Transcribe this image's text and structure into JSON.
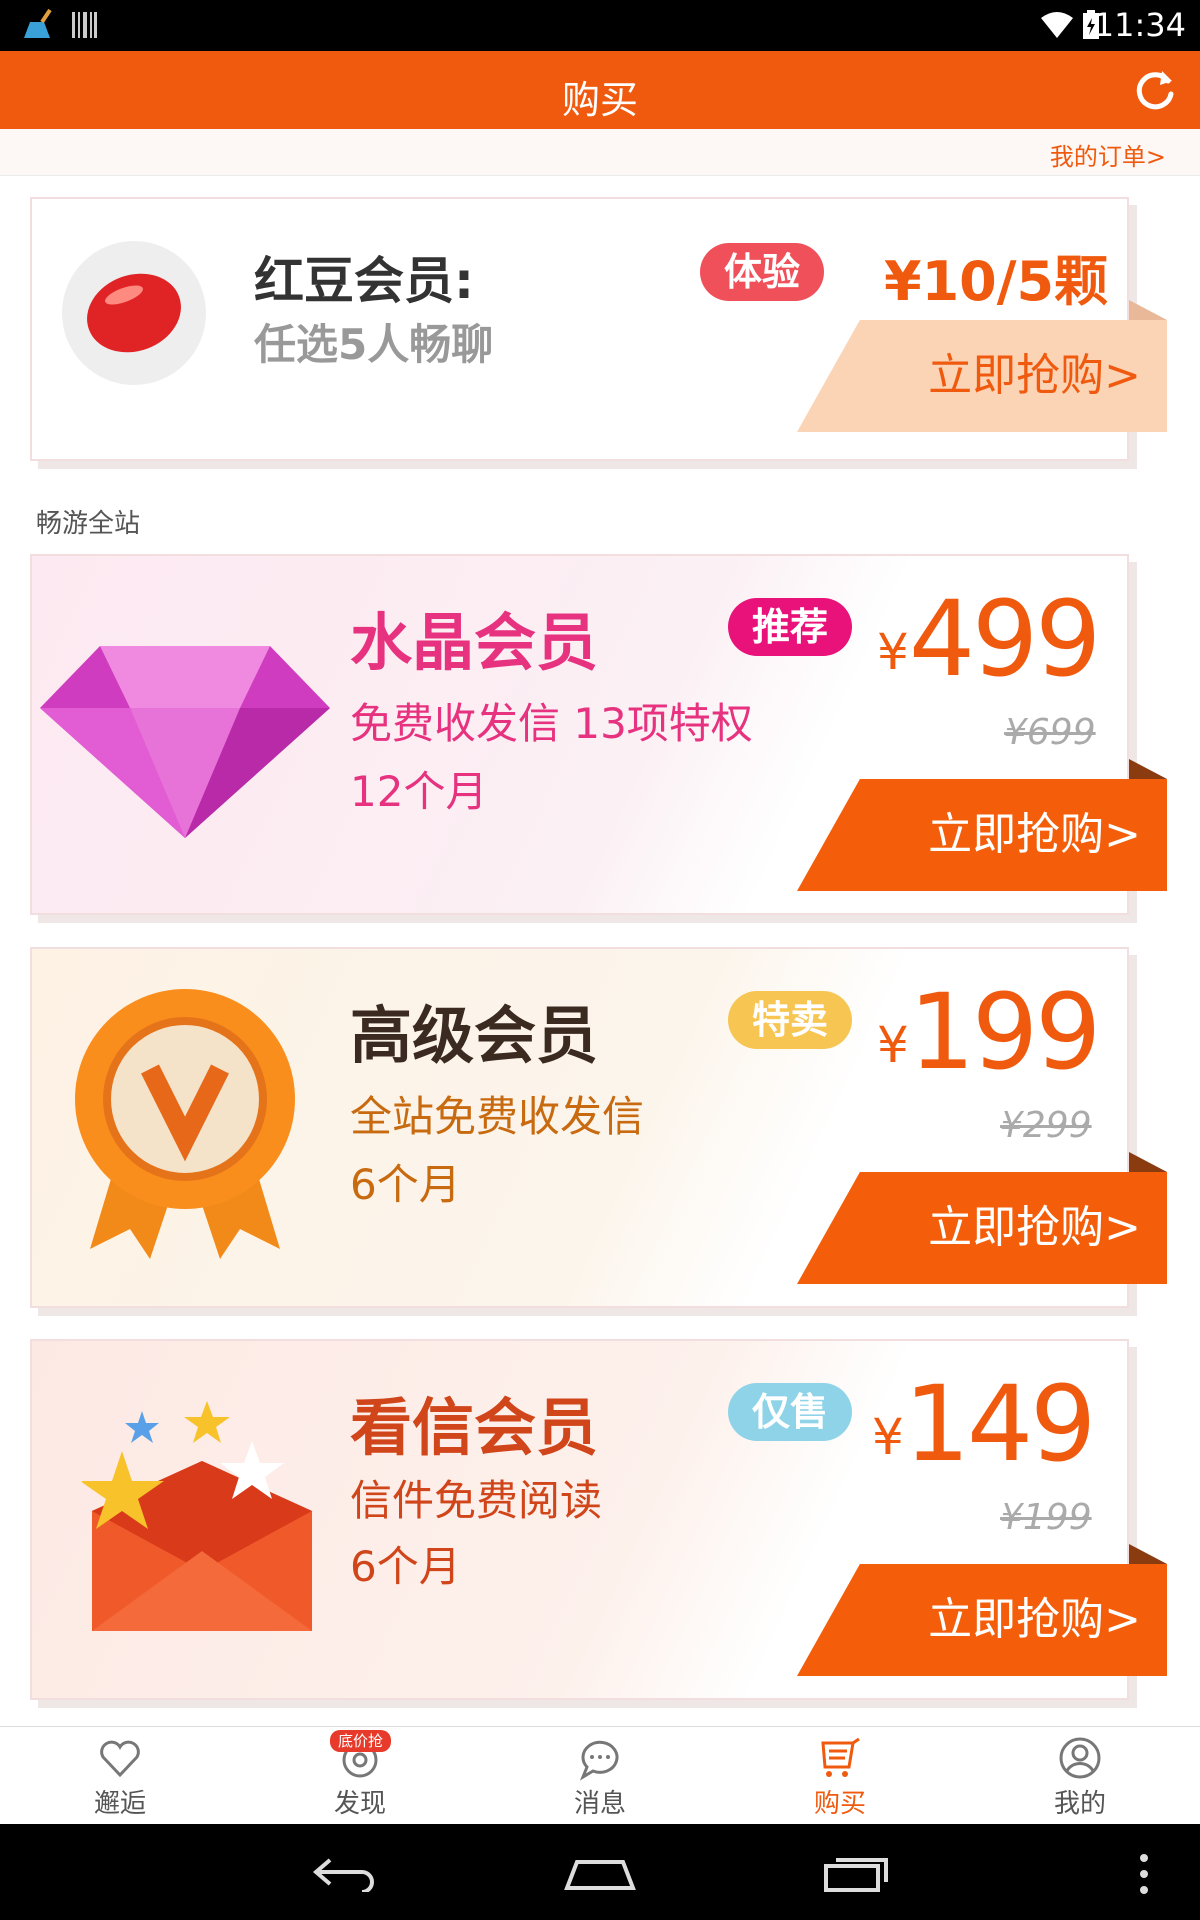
{
  "status_bar": {
    "time": "11:34"
  },
  "app_bar": {
    "title": "购买"
  },
  "orders_link": "我的订单>",
  "trial": {
    "name": "红豆会员:",
    "desc": "任选5人畅聊",
    "badge": "体验",
    "price": "¥10/5颗",
    "buy_label": "立即抢购>"
  },
  "section_label": "畅游全站",
  "plans": [
    {
      "name": "水晶会员",
      "badge": "推荐",
      "desc1": "免费收发信 13项特权",
      "desc2": "12个月",
      "currency": "¥",
      "price": "499",
      "original_price": "¥699",
      "buy_label": "立即抢购>"
    },
    {
      "name": "高级会员",
      "badge": "特卖",
      "desc1": "全站免费收发信",
      "desc2": "6个月",
      "currency": "¥",
      "price": "199",
      "original_price": "¥299",
      "buy_label": "立即抢购>"
    },
    {
      "name": "看信会员",
      "badge": "仅售",
      "desc1": "信件免费阅读",
      "desc2": "6个月",
      "currency": "¥",
      "price": "149",
      "original_price": "¥199",
      "buy_label": "立即抢购>"
    }
  ],
  "tabs": [
    {
      "label": "邂逅",
      "icon": "heart-icon"
    },
    {
      "label": "发现",
      "icon": "target-icon",
      "badge": "底价抢"
    },
    {
      "label": "消息",
      "icon": "chat-icon"
    },
    {
      "label": "购买",
      "icon": "cart-icon",
      "active": true
    },
    {
      "label": "我的",
      "icon": "user-icon"
    }
  ],
  "colors": {
    "accent": "#f05a0e",
    "crystal": "#e6327f",
    "gold": "#c86a10",
    "badge_trial": "#f0505a",
    "badge_recommend": "#e8127a",
    "badge_sale": "#f7c552",
    "badge_only": "#8fd3e8"
  }
}
